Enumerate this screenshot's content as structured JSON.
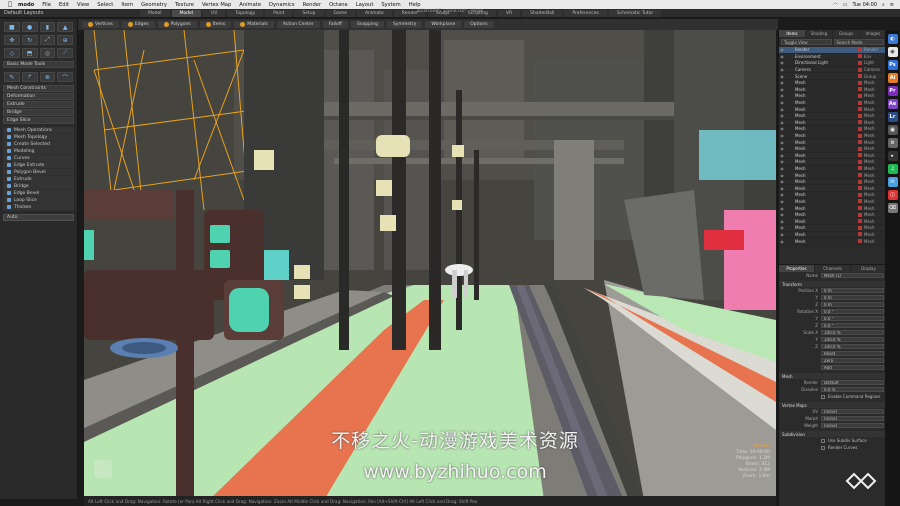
{
  "menubar": {
    "app": "modo",
    "items": [
      "File",
      "Edit",
      "View",
      "Select",
      "Item",
      "Geometry",
      "Texture",
      "Vertex Map",
      "Animate",
      "Dynamics",
      "Render",
      "Octane",
      "Layout",
      "System",
      "Help"
    ],
    "window_title": "quixtron05_scene.lxo* - Modo",
    "clock": "Tue 04:00"
  },
  "layouts": {
    "label": "Default Layouts"
  },
  "mode_tabs": [
    "Model",
    "Model",
    "UV",
    "Topology",
    "Paint",
    "Setup",
    "Game",
    "Animate",
    "Render",
    "Sculpt",
    "Scripting",
    "VR",
    "ShaderBall",
    "Preferences",
    "Schematic Tutor"
  ],
  "tool_tabs": [
    "Vertices",
    "Edges",
    "Polygons",
    "Items",
    "Materials",
    "Action Center",
    "Falloff",
    "Snapping",
    "Symmetry",
    "Workplane",
    "Options"
  ],
  "left_panel": {
    "sections": [
      "Basic Mode Tools",
      "Mesh Constraints",
      "Deformation",
      "Extrude",
      "Bridge",
      "Edge Slice"
    ],
    "items": [
      "Mesh Operations",
      "Mesh Topology",
      "Create Selected",
      "Modeling",
      "Curves",
      "Edge Extrude",
      "Polygon Bevel",
      "Extrude",
      "Bridge",
      "Edge Bevel",
      "Loop Slice",
      "Thicken"
    ],
    "dropdown": "Auto"
  },
  "viewport": {
    "hud": [
      "Time: 00:00:00",
      "Polygons: 1.2M",
      "Items: 312",
      "Vertices: 2.4M",
      "Zoom: 1.0m"
    ],
    "hud_highlight": "Render"
  },
  "statusbar": "Alt Left Click and Drag: Navigation: Rotate (or Pan)   Alt Right Click and Drag: Navigation: Zoom   Alt Middle Click and Drag: Navigation: Pan   [Alt+Shift-Ctrl] Alt Left Click and Drag: Shift Pan",
  "outliner": {
    "tabs": [
      "Items",
      "Shading",
      "Groups",
      "Images"
    ],
    "filters": [
      "Toggle View",
      "Search Mode"
    ],
    "rows": [
      {
        "name": "Render",
        "type": "Render"
      },
      {
        "name": "Environment",
        "type": "Env"
      },
      {
        "name": "Directional Light",
        "type": "Light"
      },
      {
        "name": "Camera",
        "type": "Camera"
      },
      {
        "name": "Scene",
        "type": "Group"
      },
      {
        "name": "Mesh",
        "type": "Mesh"
      },
      {
        "name": "Mesh",
        "type": "Mesh"
      },
      {
        "name": "Mesh",
        "type": "Mesh"
      },
      {
        "name": "Mesh",
        "type": "Mesh"
      },
      {
        "name": "Mesh",
        "type": "Mesh"
      },
      {
        "name": "Mesh",
        "type": "Mesh"
      },
      {
        "name": "Mesh",
        "type": "Mesh"
      },
      {
        "name": "Mesh",
        "type": "Mesh"
      },
      {
        "name": "Mesh",
        "type": "Mesh"
      },
      {
        "name": "Mesh",
        "type": "Mesh"
      },
      {
        "name": "Mesh",
        "type": "Mesh"
      },
      {
        "name": "Mesh",
        "type": "Mesh"
      },
      {
        "name": "Mesh",
        "type": "Mesh"
      },
      {
        "name": "Mesh",
        "type": "Mesh"
      },
      {
        "name": "Mesh",
        "type": "Mesh"
      },
      {
        "name": "Mesh",
        "type": "Mesh"
      },
      {
        "name": "Mesh",
        "type": "Mesh"
      },
      {
        "name": "Mesh",
        "type": "Mesh"
      },
      {
        "name": "Mesh",
        "type": "Mesh"
      },
      {
        "name": "Mesh",
        "type": "Mesh"
      },
      {
        "name": "Mesh",
        "type": "Mesh"
      },
      {
        "name": "Mesh",
        "type": "Mesh"
      },
      {
        "name": "Mesh",
        "type": "Mesh"
      },
      {
        "name": "Mesh",
        "type": "Mesh"
      },
      {
        "name": "Mesh",
        "type": "Mesh"
      }
    ]
  },
  "properties": {
    "tabs": [
      "Properties",
      "Channels",
      "Display"
    ],
    "name_label": "Name",
    "name_value": "Mesh (1)",
    "head_transform": "Transform",
    "fields": [
      {
        "label": "Position X",
        "value": "0 m"
      },
      {
        "label": "Y",
        "value": "0 m"
      },
      {
        "label": "Z",
        "value": "0 m"
      },
      {
        "label": "Rotation X",
        "value": "0.0 °"
      },
      {
        "label": "Y",
        "value": "0.0 °"
      },
      {
        "label": "Z",
        "value": "0.0 °"
      },
      {
        "label": "Scale X",
        "value": "100.0 %"
      },
      {
        "label": "Y",
        "value": "100.0 %"
      },
      {
        "label": "Z",
        "value": "100.0 %"
      }
    ],
    "buttons": [
      "Reset",
      "Zero",
      "Add"
    ],
    "head_mesh": "Mesh",
    "mesh_fields": [
      {
        "label": "Render",
        "value": "Default"
      },
      {
        "label": "Dissolve",
        "value": "0.0 %"
      }
    ],
    "checks": [
      "Enable Command Regions"
    ],
    "head_vertex": "Vertex Maps",
    "vertex_fields": [
      {
        "label": "UV",
        "value": "(none)"
      },
      {
        "label": "Morph",
        "value": "(none)"
      },
      {
        "label": "Weight",
        "value": "(none)"
      }
    ],
    "head_subdiv": "Subdivision",
    "sub_checks": [
      "Use Subdiv Surface",
      "Render Curves"
    ]
  },
  "watermark": {
    "line1": "不移之火-动漫游戏美术资源",
    "line2": "www.byzhihuo.com"
  },
  "colors": {
    "accent": "#e09a28",
    "grass": "#b8e6b2",
    "road_stripe": "#e7734f"
  }
}
